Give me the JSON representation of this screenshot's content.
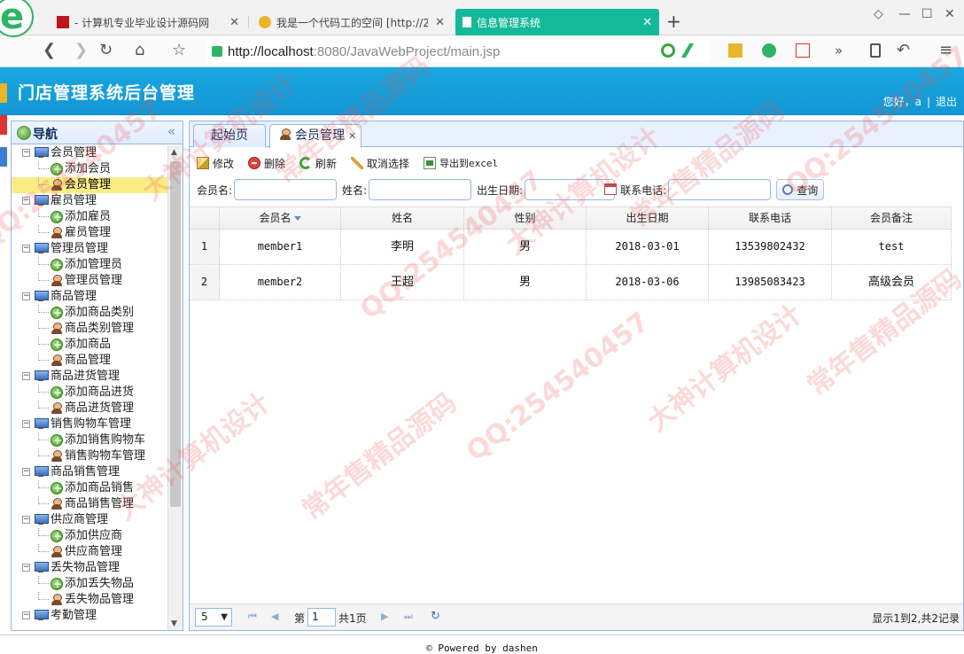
{
  "browser": {
    "tabs": [
      {
        "title": "- 计算机专业毕业设计源码网"
      },
      {
        "title": "我是一个代码工的空间 [http://2"
      },
      {
        "title": "信息管理系统"
      }
    ],
    "url_host": "http://localhost",
    "url_rest": ":8080/JavaWebProject/main.jsp"
  },
  "header": {
    "title": "门店管理系统后台管理",
    "greeting": "您好，a",
    "logout": "退出"
  },
  "sidebar": {
    "title": "导航",
    "tree": [
      {
        "type": "grp",
        "label": "会员管理"
      },
      {
        "type": "leaf",
        "icon": "plus",
        "label": "添加会员"
      },
      {
        "type": "leaf",
        "icon": "user",
        "label": "会员管理",
        "selected": true
      },
      {
        "type": "grp",
        "label": "雇员管理"
      },
      {
        "type": "leaf",
        "icon": "plus",
        "label": "添加雇员"
      },
      {
        "type": "leaf",
        "icon": "user",
        "label": "雇员管理"
      },
      {
        "type": "grp",
        "label": "管理员管理"
      },
      {
        "type": "leaf",
        "icon": "plus",
        "label": "添加管理员"
      },
      {
        "type": "leaf",
        "icon": "user",
        "label": "管理员管理"
      },
      {
        "type": "grp",
        "label": "商品管理"
      },
      {
        "type": "leaf",
        "icon": "plus",
        "label": "添加商品类别"
      },
      {
        "type": "leaf",
        "icon": "user",
        "label": "商品类别管理"
      },
      {
        "type": "leaf",
        "icon": "plus",
        "label": "添加商品"
      },
      {
        "type": "leaf",
        "icon": "user",
        "label": "商品管理"
      },
      {
        "type": "grp",
        "label": "商品进货管理"
      },
      {
        "type": "leaf",
        "icon": "plus",
        "label": "添加商品进货"
      },
      {
        "type": "leaf",
        "icon": "user",
        "label": "商品进货管理"
      },
      {
        "type": "grp",
        "label": "销售购物车管理"
      },
      {
        "type": "leaf",
        "icon": "plus",
        "label": "添加销售购物车"
      },
      {
        "type": "leaf",
        "icon": "user",
        "label": "销售购物车管理"
      },
      {
        "type": "grp",
        "label": "商品销售管理"
      },
      {
        "type": "leaf",
        "icon": "plus",
        "label": "添加商品销售"
      },
      {
        "type": "leaf",
        "icon": "user",
        "label": "商品销售管理"
      },
      {
        "type": "grp",
        "label": "供应商管理"
      },
      {
        "type": "leaf",
        "icon": "plus",
        "label": "添加供应商"
      },
      {
        "type": "leaf",
        "icon": "user",
        "label": "供应商管理"
      },
      {
        "type": "grp",
        "label": "丢失物品管理"
      },
      {
        "type": "leaf",
        "icon": "plus",
        "label": "添加丢失物品"
      },
      {
        "type": "leaf",
        "icon": "user",
        "label": "丢失物品管理"
      },
      {
        "type": "grp",
        "label": "考勤管理"
      }
    ]
  },
  "main": {
    "tabs": {
      "home": "起始页",
      "active": "会员管理"
    },
    "actions": {
      "edit": "修改",
      "delete": "删除",
      "refresh": "刷新",
      "deselect": "取消选择",
      "export": "导出到excel"
    },
    "search": {
      "member_label": "会员名:",
      "member_value": "",
      "name_label": "姓名:",
      "name_value": "",
      "birth_label": "出生日期:",
      "birth_value": "",
      "phone_label": "联系电话:",
      "phone_value": "",
      "button": "查询"
    },
    "columns": [
      "会员名",
      "姓名",
      "性别",
      "出生日期",
      "联系电话",
      "会员备注"
    ],
    "rows": [
      {
        "num": "1",
        "member": "member1",
        "name": "李明",
        "gender": "男",
        "birth": "2018-03-01",
        "phone": "13539802432",
        "note": "test"
      },
      {
        "num": "2",
        "member": "member2",
        "name": "王超",
        "gender": "男",
        "birth": "2018-03-06",
        "phone": "13985083423",
        "note": "高级会员"
      }
    ],
    "pager": {
      "page_size": "5",
      "page_prefix": "第",
      "page_value": "1",
      "page_suffix": "共1页",
      "info": "显示1到2,共2记录"
    }
  },
  "footer": {
    "text": "© Powered by dashen"
  },
  "watermark": {
    "items": [
      "QQ:254540457",
      "大神计算机设计",
      "常年售精品源码",
      "QQ:254540457",
      "大神计算机设计",
      "常年售精品源码",
      "QQ:254540457",
      "大神计算机设计",
      "常年售精品源码",
      "QQ:254540457",
      "大神计算机设计",
      "常年售精品源码"
    ]
  }
}
